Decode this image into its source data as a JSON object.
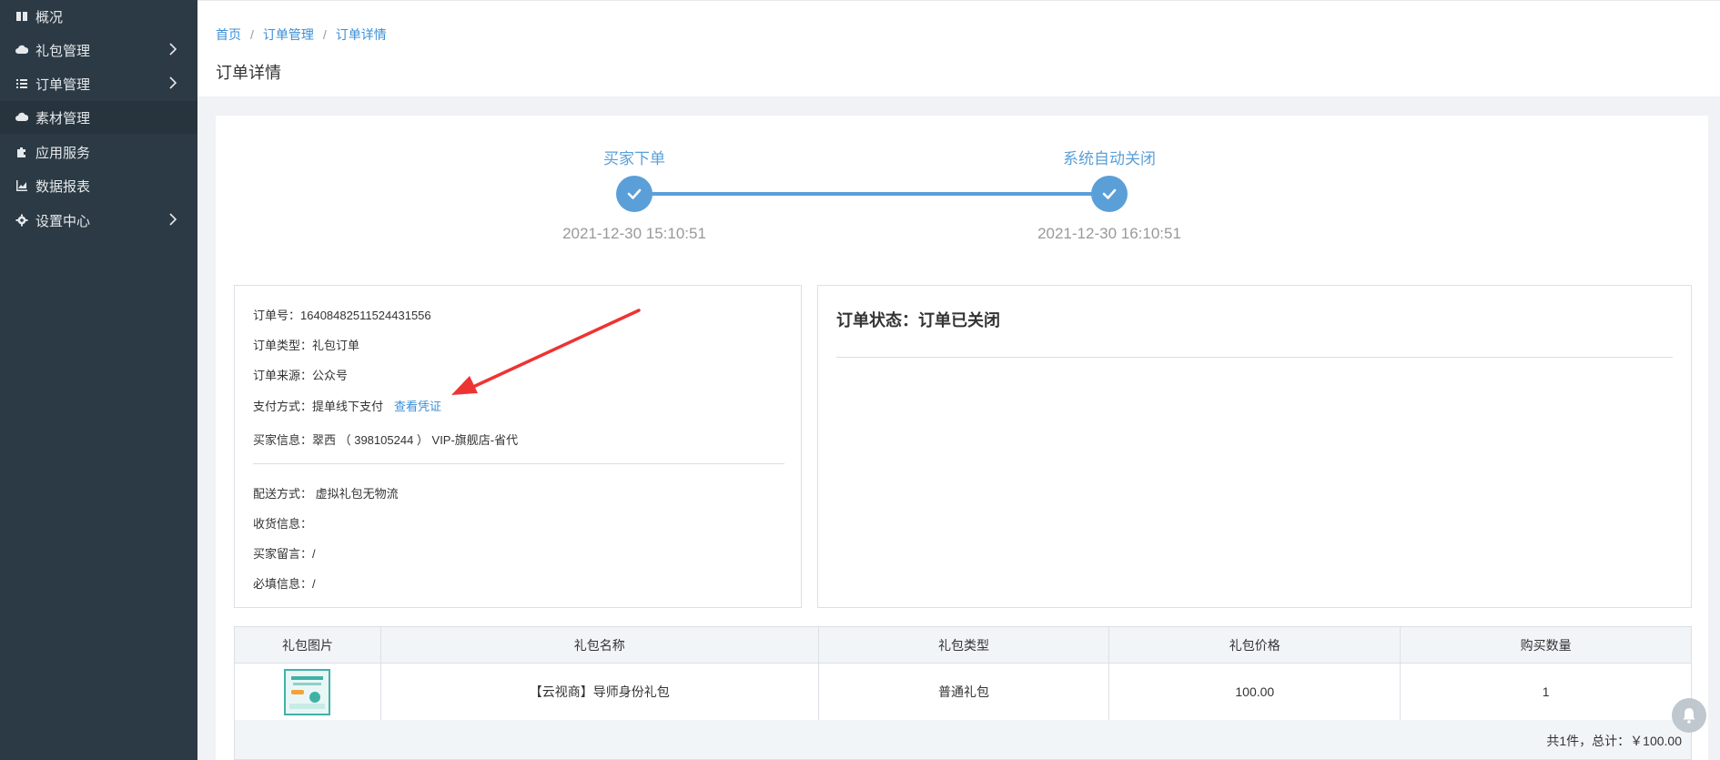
{
  "sidebar": {
    "items": [
      {
        "label": "概况",
        "icon": "book-icon",
        "has_arrow": false
      },
      {
        "label": "礼包管理",
        "icon": "cloud-icon",
        "has_arrow": true
      },
      {
        "label": "订单管理",
        "icon": "list-icon",
        "has_arrow": true
      },
      {
        "label": "素材管理",
        "icon": "cloud-icon",
        "has_arrow": false,
        "active": true
      },
      {
        "label": "应用服务",
        "icon": "puzzle-icon",
        "has_arrow": false
      },
      {
        "label": "数据报表",
        "icon": "area-chart-icon",
        "has_arrow": false
      },
      {
        "label": "设置中心",
        "icon": "gear-icon",
        "has_arrow": true
      }
    ]
  },
  "breadcrumb": {
    "items": [
      "首页",
      "订单管理",
      "订单详情"
    ],
    "separator": "/"
  },
  "page_title": "订单详情",
  "steps": [
    {
      "title": "买家下单",
      "time": "2021-12-30 15:10:51"
    },
    {
      "title": "系统自动关闭",
      "time": "2021-12-30 16:10:51"
    }
  ],
  "order_info": {
    "order_no": "订单号：16408482511524431556",
    "order_type": "订单类型：礼包订单",
    "order_source": "订单来源：公众号",
    "payment": "支付方式：提单线下支付",
    "view_voucher": "查看凭证",
    "buyer": "买家信息：翠西 （ 398105244 ） VIP-旗舰店-省代",
    "delivery": "配送方式： 虚拟礼包无物流",
    "receiver": "收货信息：",
    "buyer_message": "买家留言：/",
    "required_info": "必填信息：/"
  },
  "status": {
    "title": "订单状态：订单已关闭"
  },
  "table": {
    "headers": [
      "礼包图片",
      "礼包名称",
      "礼包类型",
      "礼包价格",
      "购买数量"
    ],
    "rows": [
      {
        "name": "【云视商】导师身份礼包",
        "type": "普通礼包",
        "price": "100.00",
        "qty": "1"
      }
    ],
    "summary": "共1件，总计：￥100.00"
  },
  "colors": {
    "sidebar_bg": "#2b3a44",
    "accent": "#5a9fd8",
    "link": "#3b8fd6",
    "arrow": "#ee3333"
  }
}
